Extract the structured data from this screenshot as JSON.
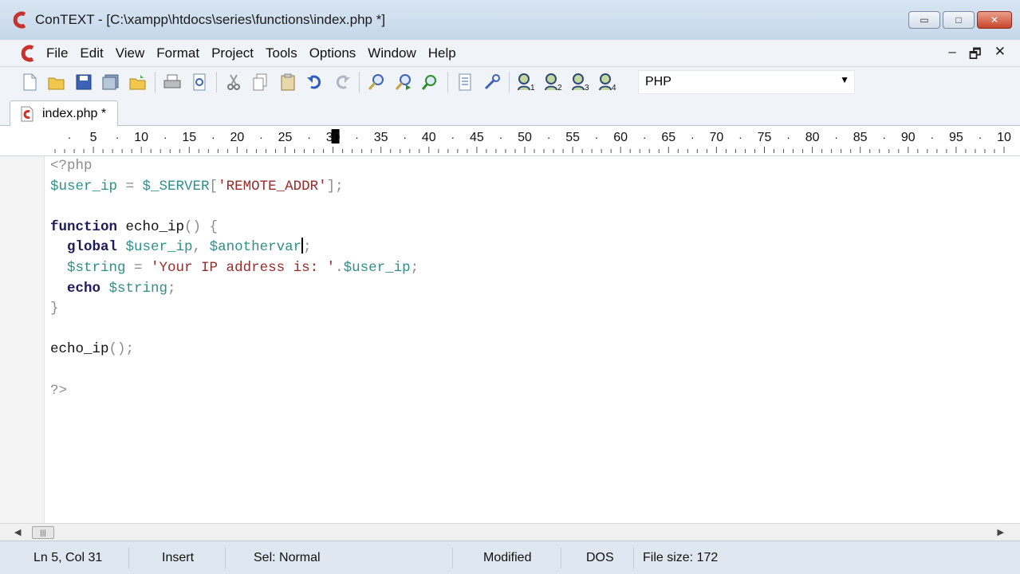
{
  "window": {
    "title": "ConTEXT - [C:\\xampp\\htdocs\\series\\functions\\index.php *]",
    "controls": {
      "minimize": "▭",
      "maximize": "□",
      "close": "✕"
    }
  },
  "menu": {
    "items": [
      "File",
      "Edit",
      "View",
      "Format",
      "Project",
      "Tools",
      "Options",
      "Window",
      "Help"
    ],
    "mdi": {
      "minimize": "–",
      "restore": "🗗",
      "close": "✕"
    }
  },
  "toolbar": {
    "icons": [
      "new-file-icon",
      "open-file-icon",
      "save-icon",
      "save-all-icon",
      "open-folder-icon",
      "print-icon",
      "print-preview-icon",
      "cut-icon",
      "copy-icon",
      "paste-icon",
      "undo-icon",
      "redo-icon",
      "find-icon",
      "find-next-icon",
      "replace-icon",
      "document-icon",
      "tools-icon",
      "user-exec-1-icon",
      "user-exec-2-icon",
      "user-exec-3-icon",
      "user-exec-4-icon"
    ],
    "language": "PHP"
  },
  "tabs": [
    {
      "label": "index.php *"
    }
  ],
  "ruler": {
    "labels": [
      "5",
      "10",
      "15",
      "20",
      "25",
      "30",
      "35",
      "40",
      "45",
      "50",
      "55",
      "60",
      "65",
      "70",
      "75",
      "80",
      "85",
      "90",
      "95",
      "10"
    ],
    "highlight": "30"
  },
  "code": {
    "line1": "<?php",
    "line2": {
      "var": "$user_ip",
      "op": " = ",
      "var2": "$_SERVER",
      "open": "[",
      "str": "'REMOTE_ADDR'",
      "close": "];"
    },
    "line4": {
      "kw": "function",
      "name": " echo_ip",
      "punc": "() {"
    },
    "line5": {
      "indent": "  ",
      "kw": "global",
      "v1": " $user_ip",
      "comma": ",",
      "v2a": " $anotherva",
      "v2b": "r",
      "semi": ";"
    },
    "line6": {
      "indent": "  ",
      "var": "$string",
      "op": " = ",
      "str": "'Your IP address is: '",
      "dot": ".",
      "var2": "$user_ip",
      "semi": ";"
    },
    "line7": {
      "indent": "  ",
      "kw": "echo",
      "var": " $string",
      "semi": ";"
    },
    "line8": "}",
    "line10": {
      "name": "echo_ip",
      "punc": "();"
    },
    "line12": "?>"
  },
  "status": {
    "position": "Ln 5, Col 31",
    "mode": "Insert",
    "sel": "Sel: Normal",
    "modified": "Modified",
    "format": "DOS",
    "filesize": "File size: 172"
  },
  "colors": {
    "keyword": "#1f1a5c",
    "variable": "#2f8f8a",
    "string": "#9a2b2b",
    "brand": "#c8322a"
  }
}
